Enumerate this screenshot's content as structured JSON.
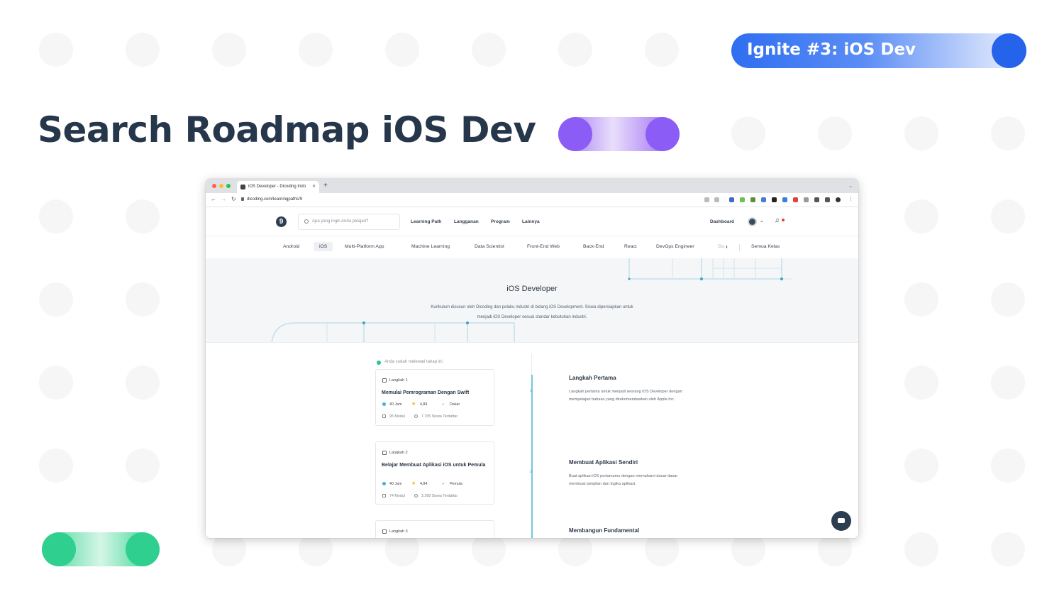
{
  "slide": {
    "badge_label": "Ignite #3: iOS Dev",
    "title": "Search Roadmap iOS Dev",
    "colors": {
      "accent_blue": "#2563eb",
      "accent_purple": "#8b5cf6",
      "accent_green": "#2fd08f",
      "title": "#26374b"
    }
  },
  "browser": {
    "tab_title": "iOS Developer - Dicoding Indo",
    "url": "dicoding.com/learningpaths/9"
  },
  "site": {
    "search_placeholder": "Apa yang ingin Anda pelajari?",
    "menu": [
      "Learning Path",
      "Langganan",
      "Program",
      "Lainnya"
    ],
    "dashboard": "Dashboard",
    "categories": [
      "Android",
      "iOS",
      "Multi-Platform App",
      "Machine Learning",
      "Data Scientist",
      "Front-End Web",
      "Back-End",
      "React",
      "DevOps Engineer",
      "Go"
    ],
    "active_category": "iOS",
    "all_classes": "Semua Kelas"
  },
  "hero": {
    "title": "iOS Developer",
    "subtitle_line1": "Kurikulum disusun oleh Dicoding dan pelaku industri di bidang iOS Development. Siswa dipersiapkan untuk",
    "subtitle_line2": "menjadi iOS Developer sesuai standar kebutuhan industri."
  },
  "roadmap": {
    "done_note": "Anda sudah melewati tahap ini.",
    "cards": [
      {
        "step": "Langkah 1",
        "title": "Memulai Pemrograman Dengan Swift",
        "hours": "40 Jam",
        "rating": "4,84",
        "level": "Dasar",
        "modules": "95 Modul",
        "students": "7.705 Siswa Terdaftar"
      },
      {
        "step": "Langkah 2",
        "title": "Belajar Membuat Aplikasi iOS untuk Pemula",
        "hours": "40 Jam",
        "rating": "4,84",
        "level": "Pemula",
        "modules": "74 Modul",
        "students": "3.268 Siswa Terdaftar"
      },
      {
        "step": "Langkah 3"
      }
    ],
    "timeline_numbers": [
      "1",
      "2"
    ],
    "steps": [
      {
        "heading": "Langkah Pertama",
        "text": "Langkah pertama untuk menjadi seorang iOS Developer dengan mempelajari bahasa yang direkomendasikan oleh Apple.Inc."
      },
      {
        "heading": "Membuat Aplikasi Sendiri",
        "text": "Buat aplikasi iOS pertamamu dengan memahami dasar-dasar membuat tampilan dan logika aplikasi."
      },
      {
        "heading": "Membangun Fundamental"
      }
    ]
  }
}
